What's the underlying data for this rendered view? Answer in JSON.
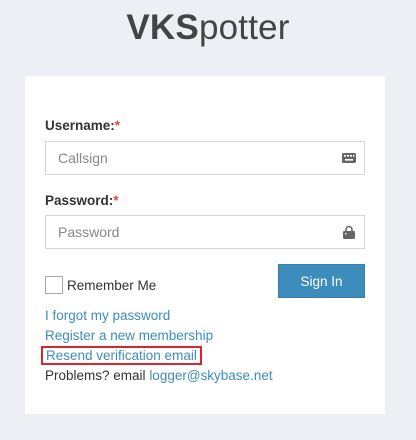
{
  "logo": {
    "bold": "VKS",
    "light": "potter"
  },
  "form": {
    "username_label": "Username:",
    "username_required": "*",
    "username_placeholder": "Callsign",
    "username_value": "",
    "password_label": "Password:",
    "password_required": "*",
    "password_placeholder": "Password",
    "password_value": "",
    "remember_label": "Remember Me",
    "remember_checked": false,
    "signin_label": "Sign In"
  },
  "links": {
    "forgot": "I forgot my password",
    "register": "Register a new membership",
    "resend": "Resend verification email",
    "problems_text": "Problems? email",
    "email": "logger@skybase.net"
  },
  "colors": {
    "accent": "#3c8dbc",
    "required": "#dd4b39",
    "highlight": "#d9262e",
    "background": "#ecf0f5"
  },
  "icons": {
    "username_field": "keyboard-icon",
    "password_field": "lock-icon"
  }
}
